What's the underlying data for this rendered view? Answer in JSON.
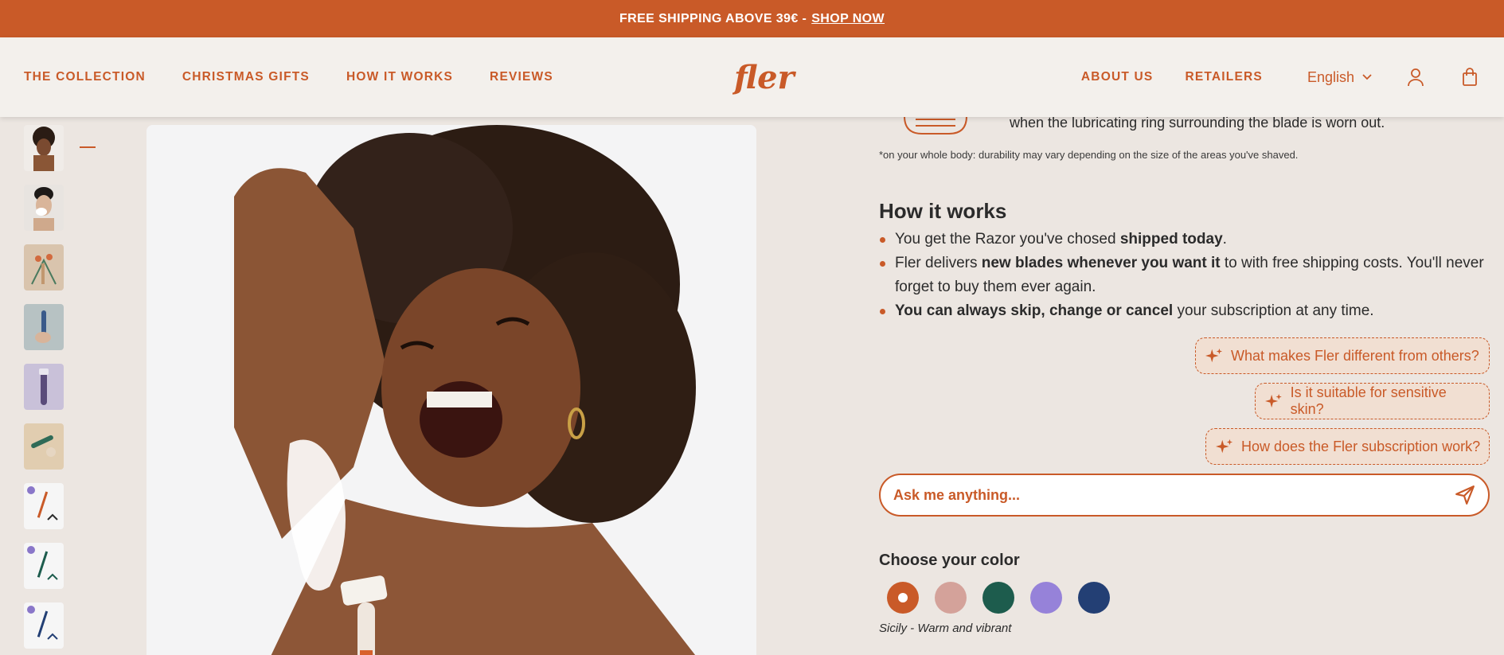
{
  "announcement": {
    "text": "FREE SHIPPING ABOVE 39€ -",
    "link": "SHOP NOW"
  },
  "nav": {
    "left": [
      "THE COLLECTION",
      "CHRISTMAS GIFTS",
      "HOW IT WORKS",
      "REVIEWS"
    ],
    "logo": "fler",
    "right": [
      "ABOUT US",
      "RETAILERS"
    ],
    "language": "English"
  },
  "thumbnails": [
    "thumb-1",
    "thumb-2",
    "thumb-3",
    "thumb-4",
    "thumb-5",
    "thumb-6",
    "thumb-7",
    "thumb-8",
    "thumb-9"
  ],
  "feature": {
    "text": "when the lubricating ring surrounding the blade is worn out.",
    "footnote": "*on your whole body: durability may vary depending on the size of the areas you've shaved."
  },
  "how_it_works": {
    "title": "How it works",
    "bullets": [
      {
        "pre": "You get the Razor you've chosed ",
        "bold": "shipped today",
        "post": "."
      },
      {
        "pre": "Fler delivers ",
        "bold": "new blades whenever you want it",
        "post": " to with free shipping costs. You'll never forget to buy them ever again."
      },
      {
        "pre": "",
        "bold": "You can always skip, change or cancel",
        "post": " your subscription at any time."
      }
    ]
  },
  "questions": [
    "What makes Fler different from others?",
    "Is it suitable for sensitive skin?",
    "How does the Fler subscription work?"
  ],
  "ask": {
    "placeholder": "Ask me anything..."
  },
  "color": {
    "title": "Choose your color",
    "swatches": [
      "#c95a28",
      "#d4a29a",
      "#1d5c4d",
      "#9682d9",
      "#233f74"
    ],
    "selected": "Sicily - Warm and vibrant"
  },
  "colors": {
    "accent": "#c95a28",
    "background": "#ece6e1"
  }
}
